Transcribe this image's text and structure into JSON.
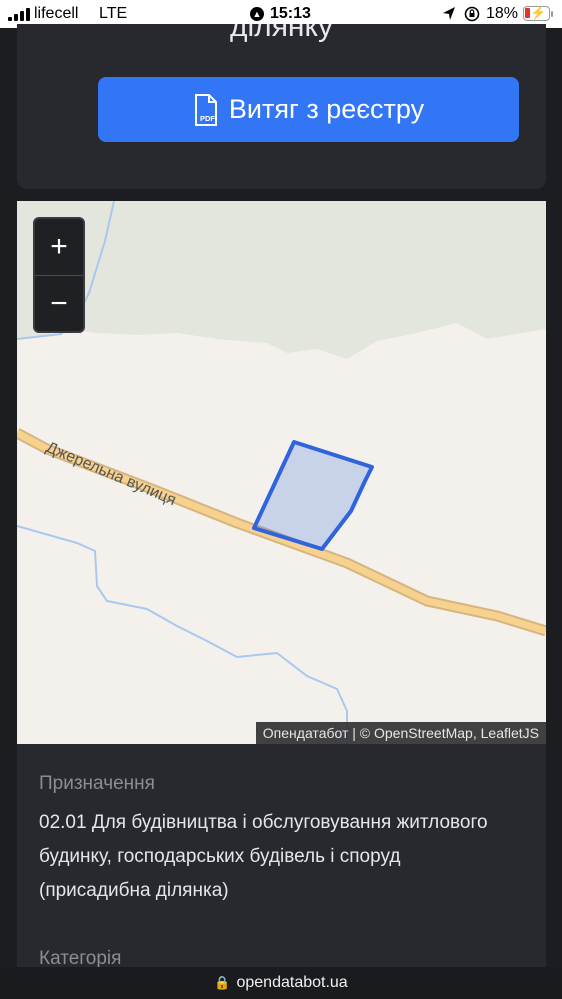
{
  "status_bar": {
    "carrier": "lifecell",
    "network": "LTE",
    "time": "15:13",
    "battery": "18%"
  },
  "header": {
    "title_partial": "ділянку"
  },
  "actions": {
    "pdf_button_label": "Витяг з реєстру",
    "pdf_icon_text": "PDF"
  },
  "map": {
    "street_label": "Джерельна вулиця",
    "zoom_in": "+",
    "zoom_out": "−",
    "attribution": "Опендатабот | © OpenStreetMap, LeafletJS",
    "parcel_color": "#2f63e0",
    "road_color": "#f6d28e"
  },
  "details": {
    "purpose_label": "Призначення",
    "purpose_value": "02.01 Для будівництва і обслуговування житлового будинку, господарських будівель і споруд (присадибна ділянка)",
    "category_label": "Категорія"
  },
  "browser": {
    "url": "opendatabot.ua"
  }
}
